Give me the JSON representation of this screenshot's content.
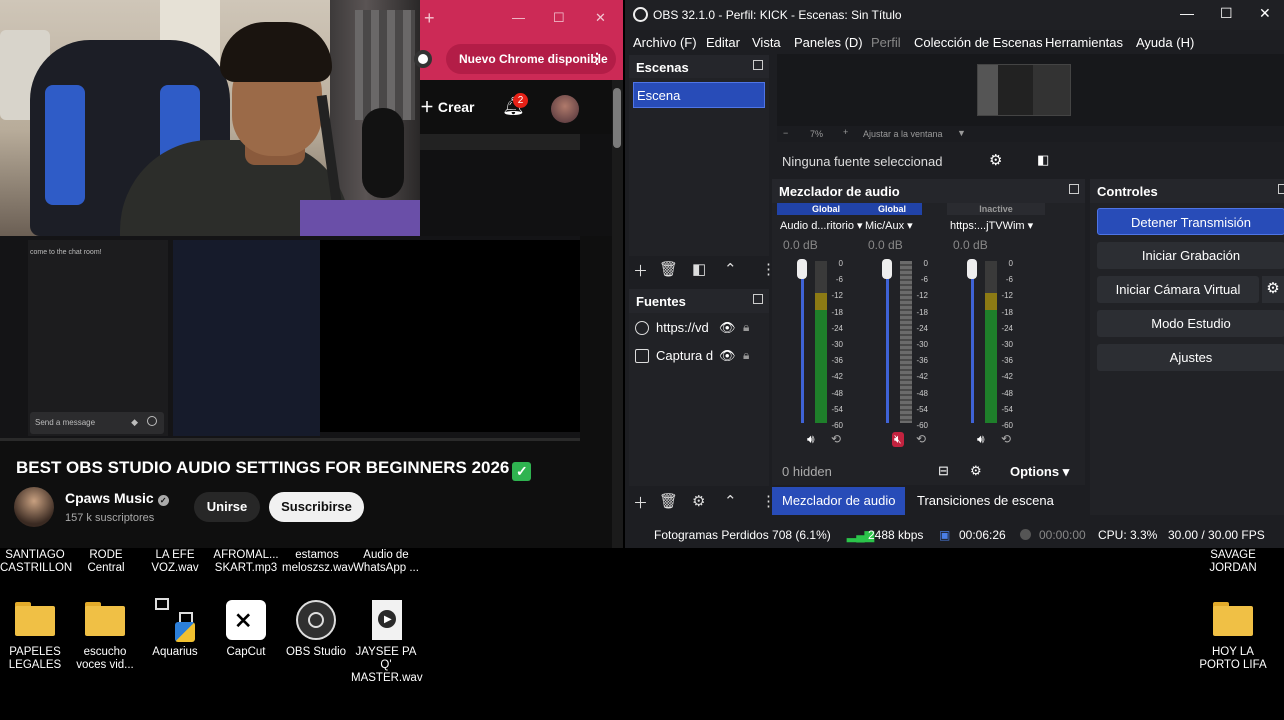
{
  "chrome": {
    "update_banner": "Nuevo Chrome disponible",
    "create_label": "Crear",
    "notification_count": "2"
  },
  "youtube": {
    "chat_message": "come to the chat room!",
    "chat_placeholder": "Send a message",
    "video_title": "BEST OBS STUDIO AUDIO SETTINGS FOR BEGINNERS 2026",
    "channel_name": "Cpaws Music",
    "subscribers": "157 k suscriptores",
    "join_label": "Unirse",
    "subscribe_label": "Suscribirse"
  },
  "obs": {
    "window_title": "OBS 32.1.0 - Perfil: KICK - Escenas: Sin Título",
    "menu": [
      "Archivo (F)",
      "Editar",
      "Vista",
      "Paneles (D)",
      "Perfil",
      "Colección de Escenas",
      "Herramientas",
      "Ayuda (H)"
    ],
    "scenes_title": "Escenas",
    "scene_item": "Escena",
    "sources_title": "Fuentes",
    "sources": [
      "https://vd",
      "Captura d"
    ],
    "zoom_text": "7%",
    "fit_window": "Ajustar a la ventana",
    "no_source": "Ninguna fuente seleccionad",
    "mixer_title": "Mezclador de audio",
    "channels": [
      {
        "header": "Global",
        "name": "Audio d...ritorio",
        "db": "0.0 dB",
        "level": 0.8
      },
      {
        "header": "Global",
        "name": "Mic/Aux",
        "db": "0.0 dB",
        "level": 0.0
      },
      {
        "header": "Inactive",
        "name": "https:...jTVWim",
        "db": "0.0 dB",
        "level": 0.8
      }
    ],
    "meter_scale": [
      "0",
      "-6",
      "-12",
      "-18",
      "-24",
      "-30",
      "-36",
      "-42",
      "-48",
      "-54",
      "-60"
    ],
    "hidden_count": "0 hidden",
    "options_label": "Options",
    "tab_mixer": "Mezclador de audio",
    "tab_transitions": "Transiciones de escena",
    "controls_title": "Controles",
    "controls": [
      "Detener Transmisión",
      "Iniciar Grabación",
      "Iniciar Cámara Virtual",
      "Modo Estudio",
      "Ajustes"
    ],
    "status": {
      "dropped_frames": "Fotogramas Perdidos 708 (6.1%)",
      "bitrate": "2488 kbps",
      "stream_time": "00:06:26",
      "rec_time": "00:00:00",
      "cpu": "CPU: 3.3%",
      "fps": "30.00 / 30.00 FPS"
    }
  },
  "desktop": {
    "top_row": [
      "SANTIAGO CASTRILLON",
      "RODE Central",
      "LA EFE VOZ.wav",
      "AFROMAL... SKART.mp3",
      "estamos meloszsz.wav",
      "Audio de WhatsApp ...",
      "SAVAGE JORDAN"
    ],
    "icons": [
      "PAPELES LEGALES",
      "escucho voces vid...",
      "Aquarius",
      "CapCut",
      "OBS Studio",
      "JAYSEE PA Q' MASTER.wav",
      "HOY LA PORTO LIFA"
    ]
  }
}
